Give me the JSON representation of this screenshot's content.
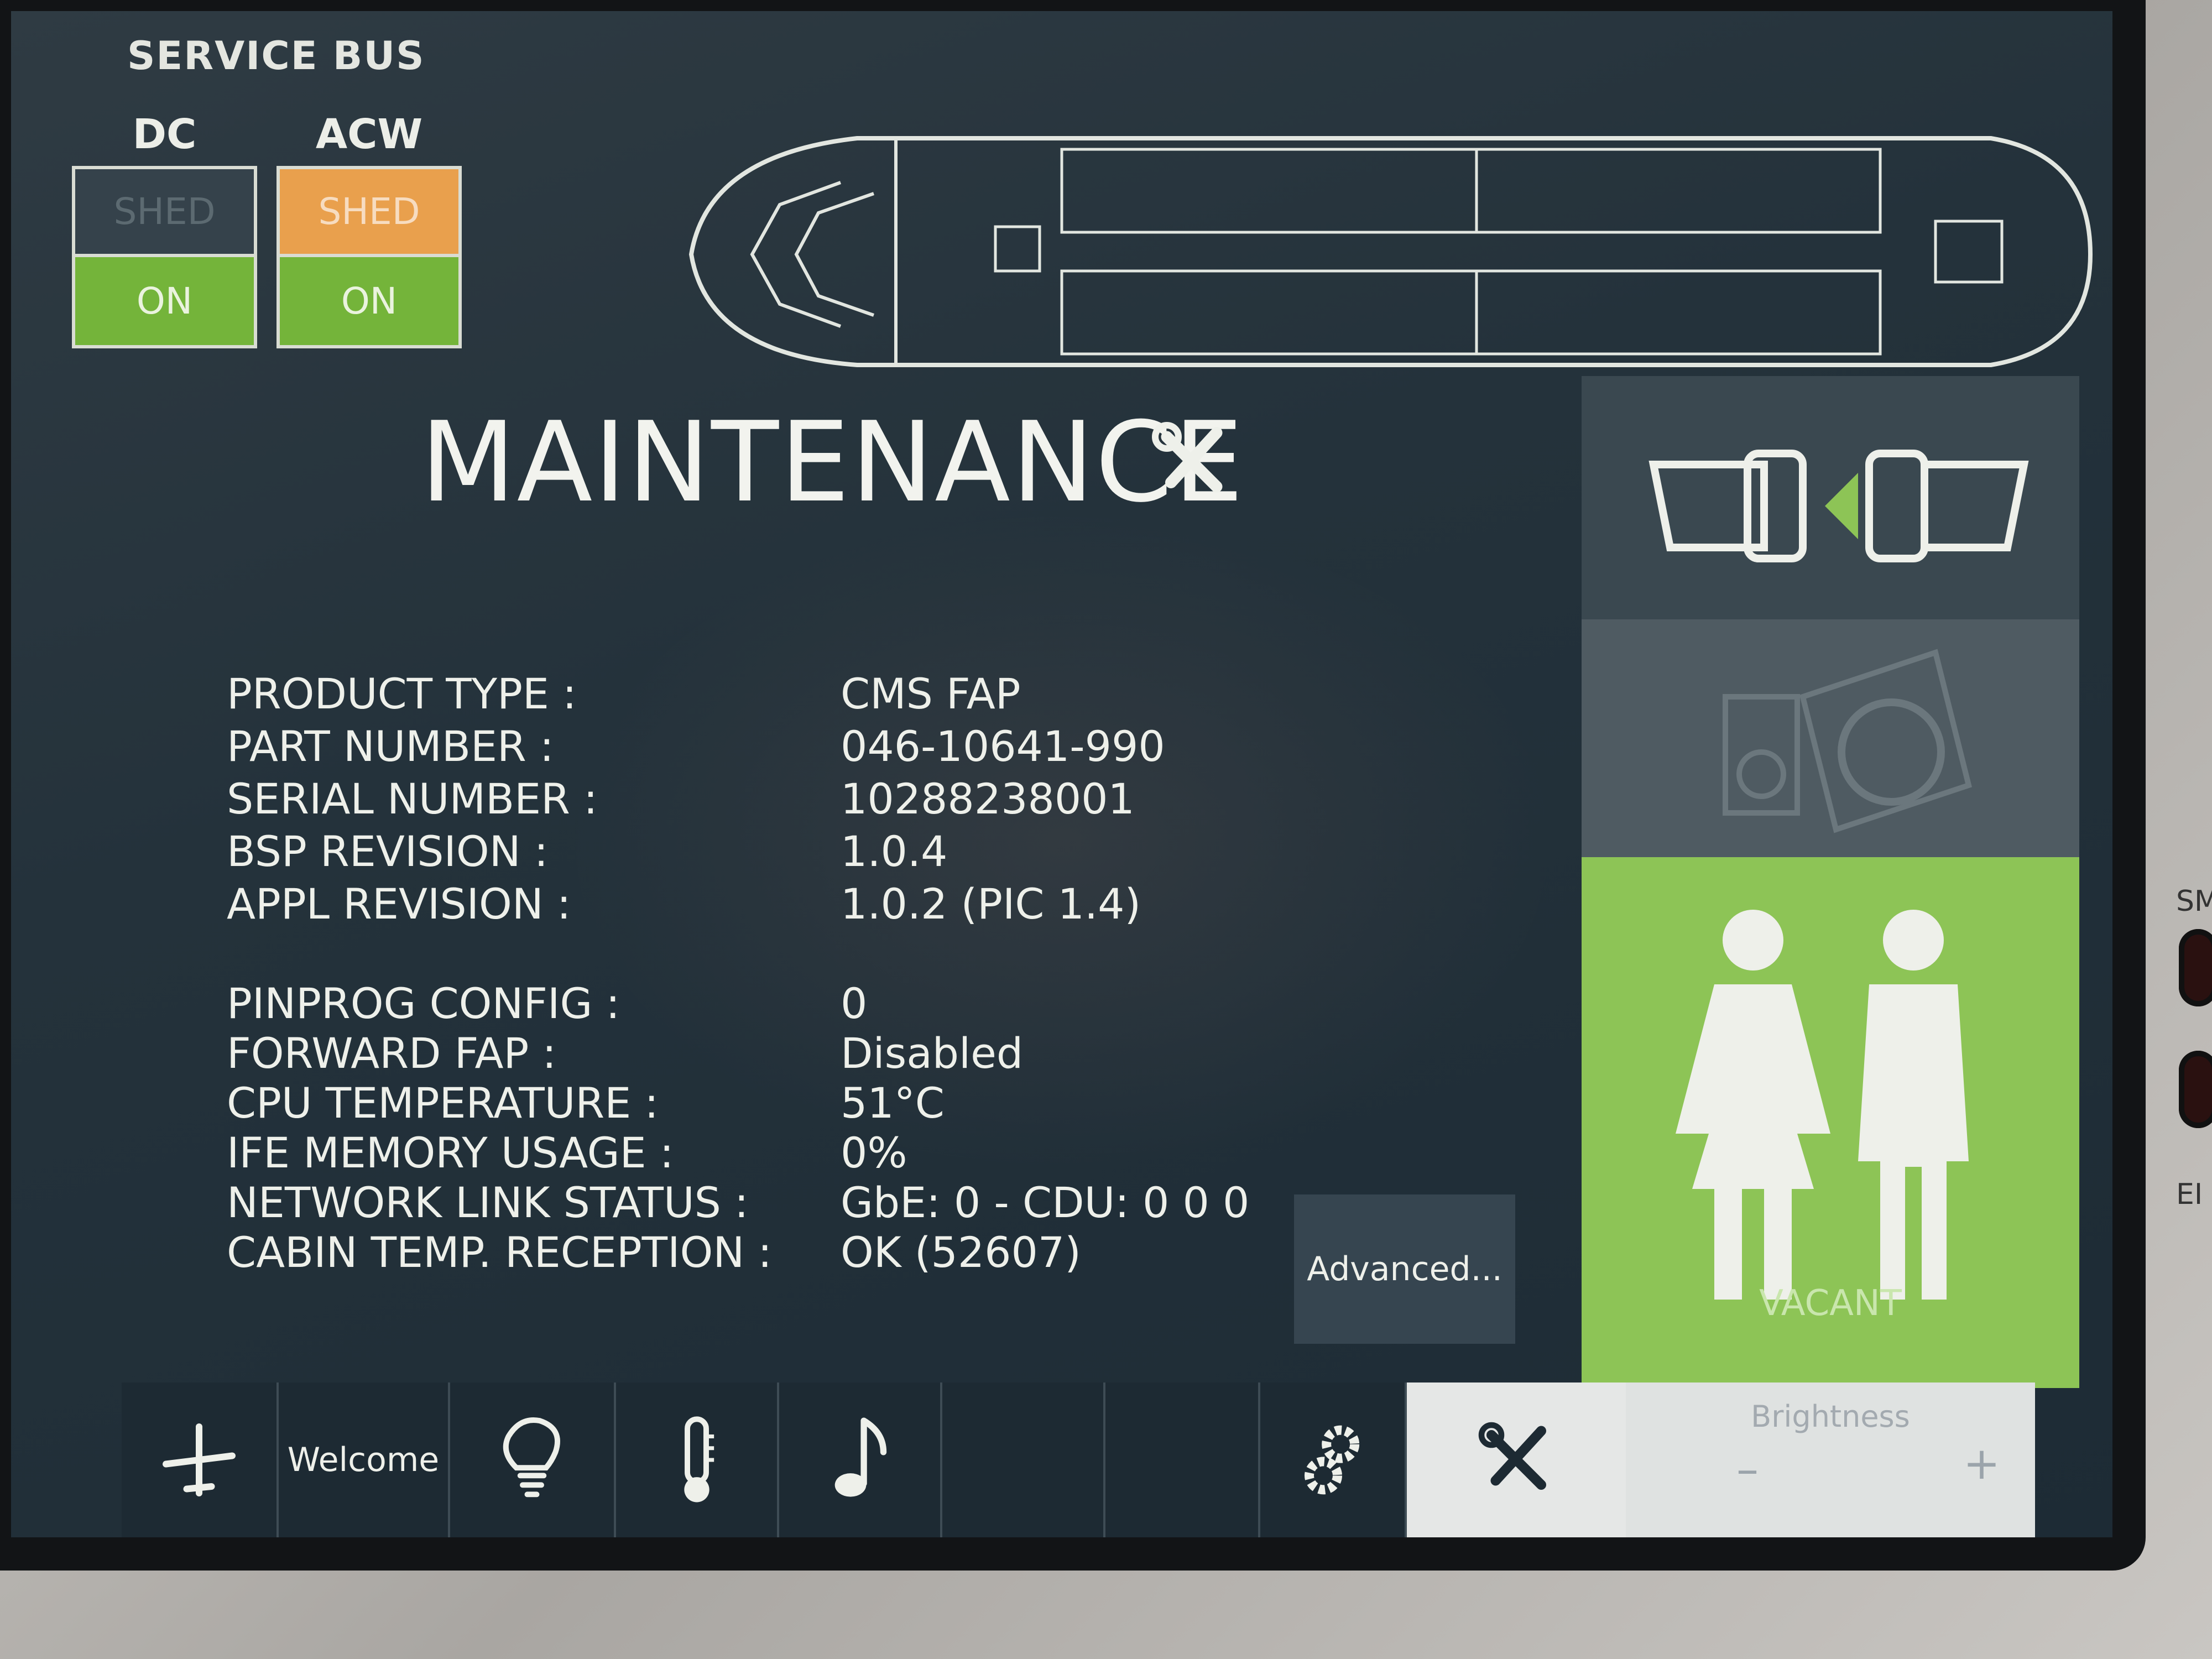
{
  "service_bus": {
    "title": "SERVICE BUS",
    "columns": [
      {
        "name": "DC",
        "shed": "SHED",
        "shed_active": false,
        "on": "ON"
      },
      {
        "name": "ACW",
        "shed": "SHED",
        "shed_active": true,
        "on": "ON"
      }
    ]
  },
  "page": {
    "title": "MAINTENANCE",
    "title_icon": "wrench-screwdriver-icon"
  },
  "info": [
    {
      "label": "PRODUCT TYPE :",
      "value": "CMS FAP"
    },
    {
      "label": "PART NUMBER :",
      "value": "046-10641-990"
    },
    {
      "label": "SERIAL NUMBER :",
      "value": "10288238001"
    },
    {
      "label": "BSP REVISION :",
      "value": "1.0.4"
    },
    {
      "label": "APPL REVISION :",
      "value": "1.0.2 (PIC 1.4)"
    },
    {
      "label": "PINPROG CONFIG :",
      "value": "0"
    },
    {
      "label": "FORWARD FAP :",
      "value": "Disabled"
    },
    {
      "label": "CPU TEMPERATURE :",
      "value": "51°C"
    },
    {
      "label": "IFE MEMORY USAGE :",
      "value": "0%"
    },
    {
      "label": "NETWORK LINK STATUS :",
      "value": "GbE: 0 - CDU: 0 0 0"
    },
    {
      "label": "CABIN TEMP. RECEPTION :",
      "value": "OK (52607)"
    }
  ],
  "advanced_button": "Advanced...",
  "right_panel": {
    "seatbelt_icon": "seatbelt-icon",
    "music_icon": "audio-player-icon",
    "lavatory_icon": "lavatory-icon",
    "lavatory_status": "VACANT"
  },
  "bottom_nav": {
    "items": [
      {
        "icon": "airplane-icon"
      },
      {
        "label": "Welcome"
      },
      {
        "icon": "lightbulb-icon"
      },
      {
        "icon": "thermometer-icon"
      },
      {
        "icon": "music-note-icon"
      },
      {
        "icon": "blank"
      },
      {
        "icon": "blank"
      },
      {
        "icon": "gears-icon"
      },
      {
        "icon": "wrench-screwdriver-icon"
      }
    ],
    "brightness": {
      "label": "Brightness",
      "minus": "–",
      "plus": "+"
    }
  },
  "bezel": {
    "side_labels": [
      "SM",
      "EI"
    ]
  },
  "colors": {
    "shed_active": "#e9a04d",
    "on_green": "#74b43a",
    "vacant_green": "#8dc456",
    "screen_bg": "#24323b"
  }
}
